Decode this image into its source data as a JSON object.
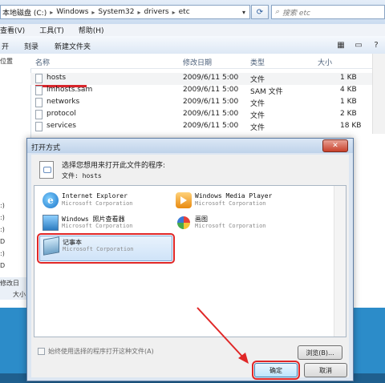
{
  "address_bar": {
    "path": [
      "本地磁盘 (C:)",
      "Windows",
      "System32",
      "drivers",
      "etc"
    ],
    "search_placeholder": "搜索 etc"
  },
  "menu": [
    "查看(V)",
    "工具(T)",
    "帮助(H)"
  ],
  "toolbar": {
    "open": "开",
    "burn": "刻录",
    "new_folder": "新建文件夹"
  },
  "nav": {
    "items": [
      "位置",
      ":)",
      ":)",
      ":)",
      "D",
      ":)",
      "D"
    ]
  },
  "status": {
    "modified": "修改日",
    "size": "大小"
  },
  "columns": {
    "name": "名称",
    "modified": "修改日期",
    "type": "类型",
    "size": "大小"
  },
  "files": [
    {
      "name": "hosts",
      "date": "2009/6/11 5:00",
      "type": "文件",
      "size": "1 KB"
    },
    {
      "name": "lmhosts.sam",
      "date": "2009/6/11 5:00",
      "type": "SAM 文件",
      "size": "4 KB"
    },
    {
      "name": "networks",
      "date": "2009/6/11 5:00",
      "type": "文件",
      "size": "1 KB"
    },
    {
      "name": "protocol",
      "date": "2009/6/11 5:00",
      "type": "文件",
      "size": "2 KB"
    },
    {
      "name": "services",
      "date": "2009/6/11 5:00",
      "type": "文件",
      "size": "18 KB"
    }
  ],
  "dialog": {
    "title": "打开方式",
    "close": "✕",
    "instruction": "选择您想用来打开此文件的程序:",
    "file_label": "文件:  hosts",
    "programs": [
      {
        "name": "Internet Explorer",
        "company": "Microsoft Corporation"
      },
      {
        "name": "Windows Media Player",
        "company": "Microsoft Corporation"
      },
      {
        "name": "Windows 照片查看器",
        "company": "Microsoft Corporation"
      },
      {
        "name": "画图",
        "company": "Microsoft Corporation"
      },
      {
        "name": "记事本",
        "company": "Microsoft Corporation"
      }
    ],
    "always_use": "始终使用选择的程序打开这种文件(A)",
    "browse": "浏览(B)...",
    "ok": "确定",
    "cancel": "取消"
  },
  "colors": {
    "highlight_red": "#e02727",
    "selection_blue": "#cfe3f8",
    "desktop_blue": "#2c8cc9"
  }
}
